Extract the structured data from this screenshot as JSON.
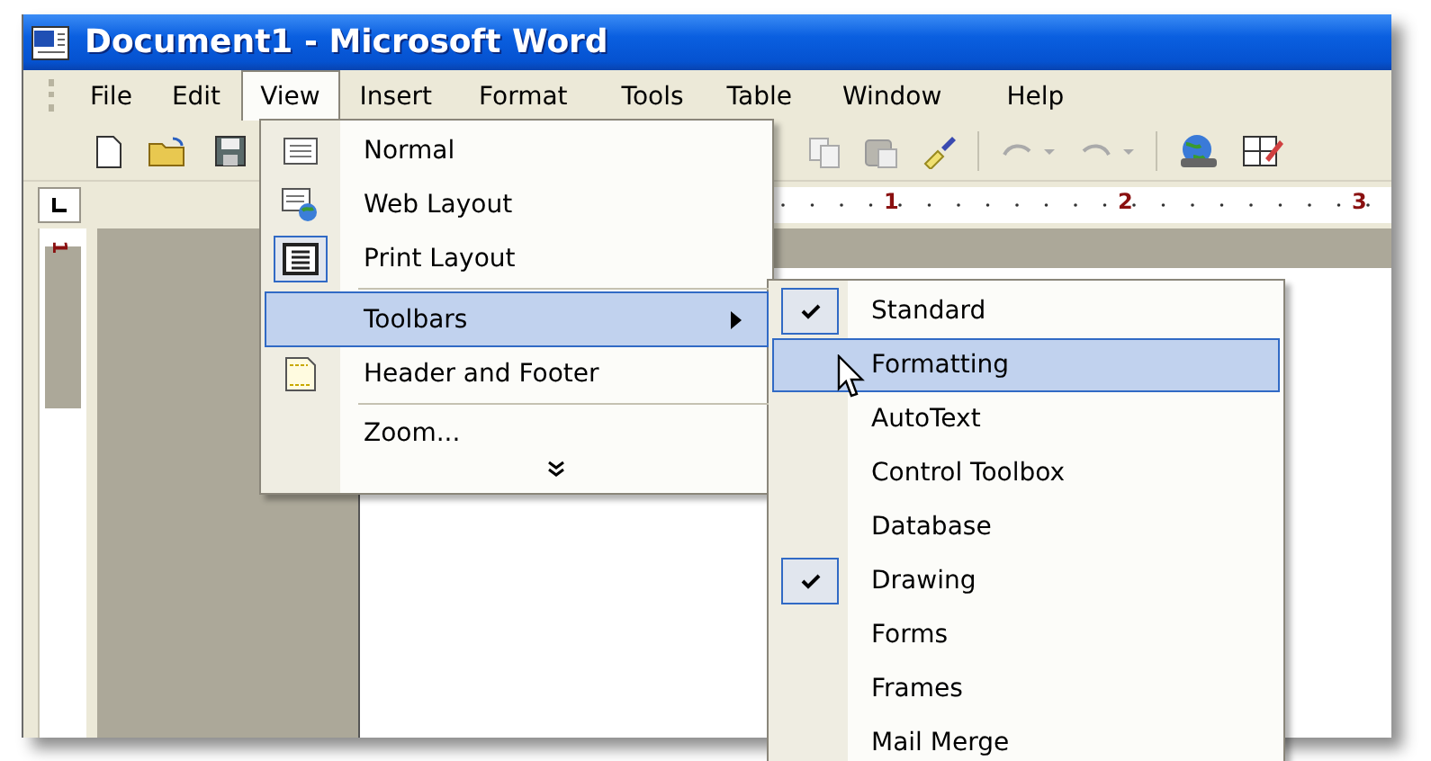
{
  "window": {
    "title": "Document1 - Microsoft Word"
  },
  "menu_bar": [
    {
      "label": "File",
      "selected": false
    },
    {
      "label": "Edit",
      "selected": false
    },
    {
      "label": "View",
      "selected": true
    },
    {
      "label": "Insert",
      "selected": false
    },
    {
      "label": "Format",
      "selected": false
    },
    {
      "label": "Tools",
      "selected": false
    },
    {
      "label": "Table",
      "selected": false
    },
    {
      "label": "Window",
      "selected": false
    },
    {
      "label": "Help",
      "selected": false
    }
  ],
  "ruler": {
    "marks": [
      "1",
      "2",
      "3"
    ]
  },
  "vertical_ruler": {
    "mark": "1"
  },
  "view_menu": {
    "items": [
      {
        "kind": "item",
        "label": "Normal",
        "checked": false,
        "selected": false,
        "separator_before": false
      },
      {
        "kind": "item",
        "label": "Web Layout",
        "checked": false,
        "selected": false,
        "separator_before": false
      },
      {
        "kind": "item",
        "label": "Print Layout",
        "checked": true,
        "selected": false,
        "separator_before": false
      },
      {
        "kind": "submenu",
        "label": "Toolbars",
        "selected": true,
        "separator_before": true
      },
      {
        "kind": "item",
        "label": "Header and Footer",
        "checked": false,
        "selected": false,
        "separator_before": false
      },
      {
        "kind": "item",
        "label": "Zoom...",
        "selected": false,
        "separator_before": true
      },
      {
        "kind": "expand"
      }
    ]
  },
  "toolbars_menu": {
    "items": [
      {
        "label": "Standard",
        "checked": true,
        "selected": false
      },
      {
        "label": "Formatting",
        "checked": false,
        "selected": true
      },
      {
        "label": "AutoText",
        "checked": false,
        "selected": false
      },
      {
        "label": "Control Toolbox",
        "checked": false,
        "selected": false
      },
      {
        "label": "Database",
        "checked": false,
        "selected": false
      },
      {
        "label": "Drawing",
        "checked": true,
        "selected": false
      },
      {
        "label": "Forms",
        "checked": false,
        "selected": false
      },
      {
        "label": "Frames",
        "checked": false,
        "selected": false
      },
      {
        "label": "Mail Merge",
        "checked": false,
        "selected": false
      }
    ]
  }
}
